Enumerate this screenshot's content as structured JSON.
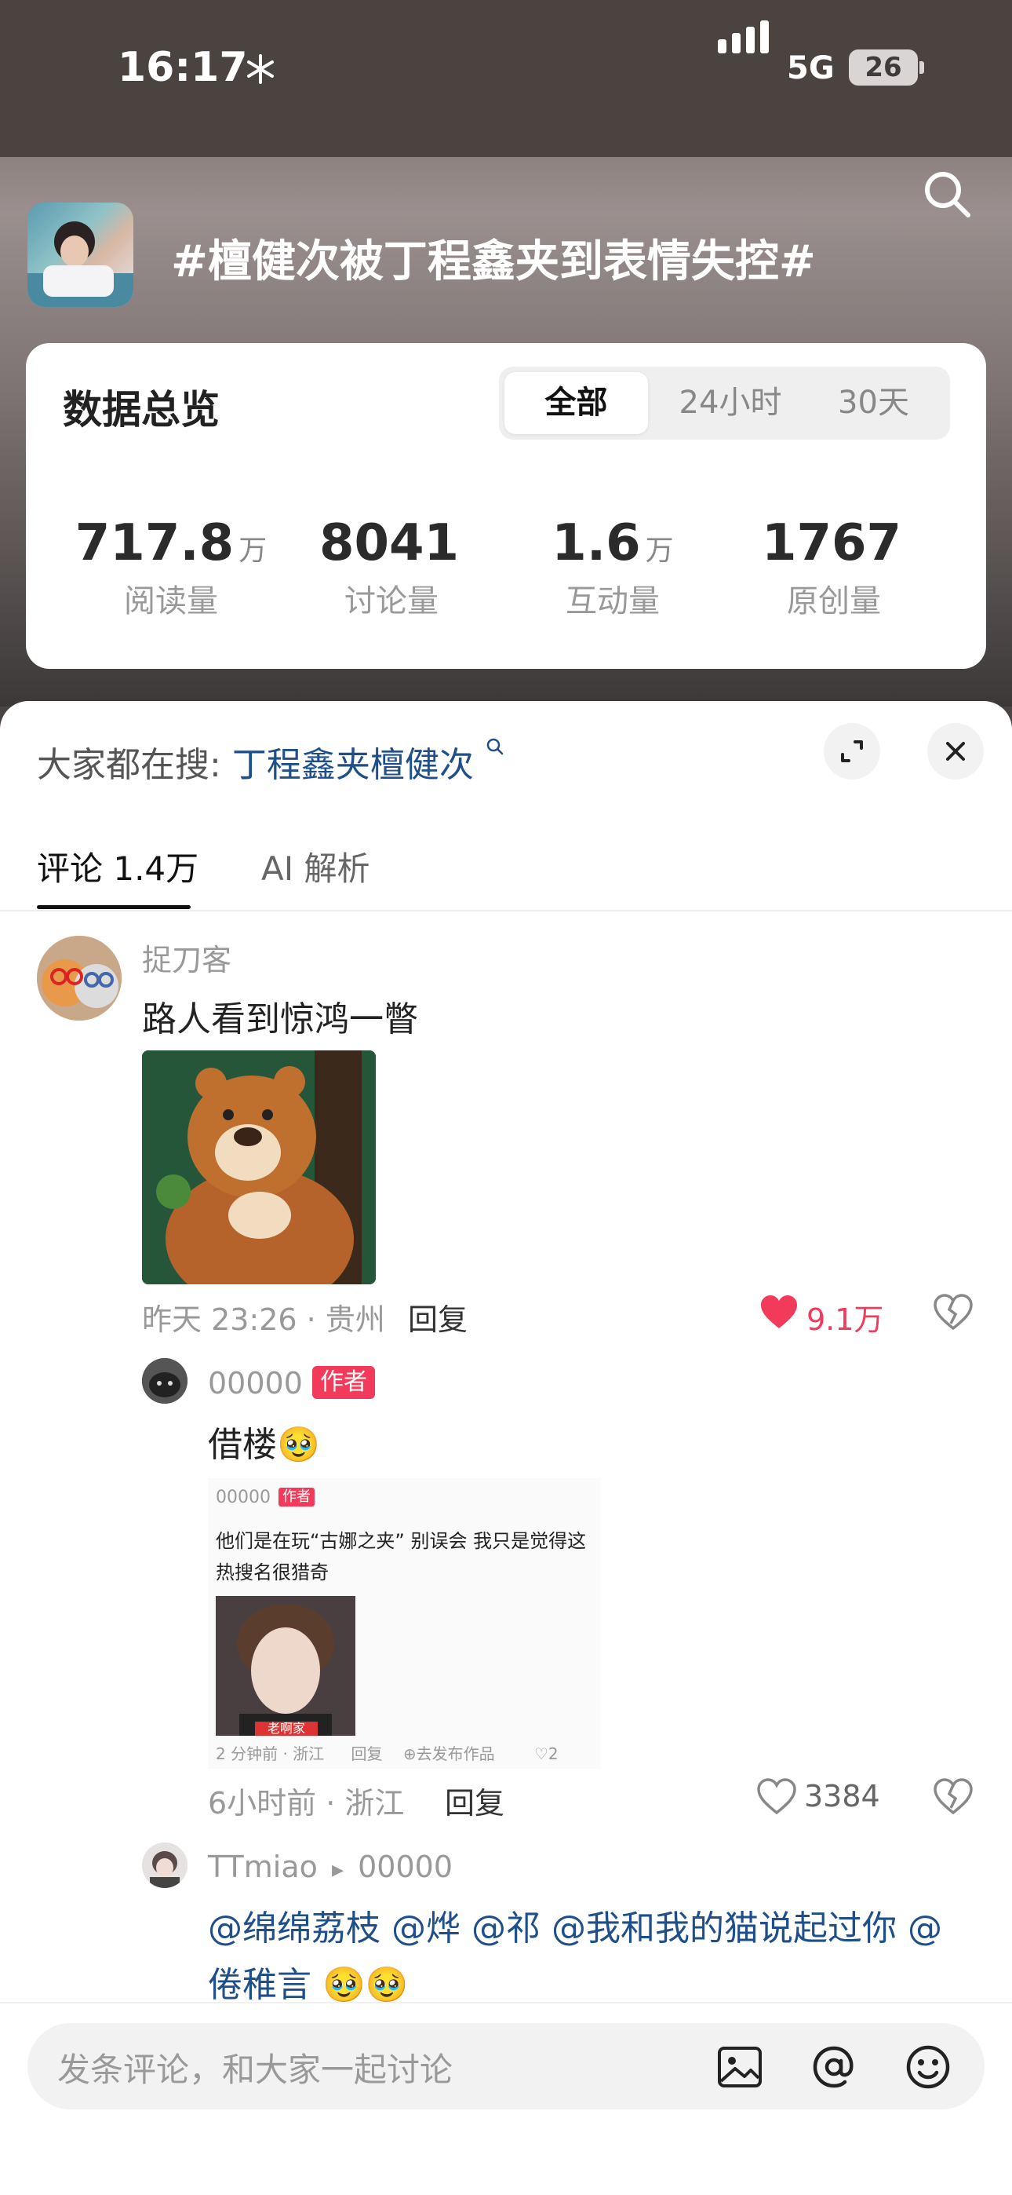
{
  "status_bar": {
    "time": "16:17",
    "network": "5G",
    "battery": "26"
  },
  "topic": {
    "title": "#檀健次被丁程鑫夹到表情失控#"
  },
  "overview": {
    "title": "数据总览",
    "segments": [
      "全部",
      "24小时",
      "30天"
    ],
    "stats": [
      {
        "value": "717.8",
        "unit": "万",
        "label": "阅读量"
      },
      {
        "value": "8041",
        "unit": "",
        "label": "讨论量"
      },
      {
        "value": "1.6",
        "unit": "万",
        "label": "互动量"
      },
      {
        "value": "1767",
        "unit": "",
        "label": "原创量"
      }
    ]
  },
  "sheet": {
    "hot_search_label": "大家都在搜:",
    "hot_search_link": "丁程鑫夹檀健次",
    "tabs": [
      "评论 1.4万",
      "AI 解析"
    ]
  },
  "comments": [
    {
      "user": "捉刀客",
      "text": "路人看到惊鸿一瞥",
      "meta": "昨天 23:26 · 贵州",
      "reply": "回复",
      "likes": "9.1万"
    }
  ],
  "reply": {
    "user": "00000",
    "badge": "作者",
    "text": "借楼🥹",
    "meta": "6小时前 · 浙江",
    "reply": "回复",
    "likes": "3384",
    "screenshot": {
      "name": "00000",
      "badge": "作者",
      "line1": "他们是在玩“古娜之夹” 别误会 我只是觉得这",
      "line2": "热搜名很猎奇",
      "photo_caption": "老啊家",
      "meta": "2 分钟前 · 浙江",
      "reply": "回复",
      "publish": "⊕去发布作品",
      "likes": "♡2"
    }
  },
  "reply2": {
    "user": "TTmiao",
    "arrow": "▸",
    "target": "00000",
    "line1": "@绵绵荔枝 @烨 @祁 @我和我的猫说起过你 @",
    "line2": "倦稚言 🥹🥹"
  },
  "input": {
    "placeholder": "发条评论，和大家一起讨论"
  },
  "colors": {
    "accent_red": "#f23a5a",
    "link_blue": "#1f4f8a"
  }
}
